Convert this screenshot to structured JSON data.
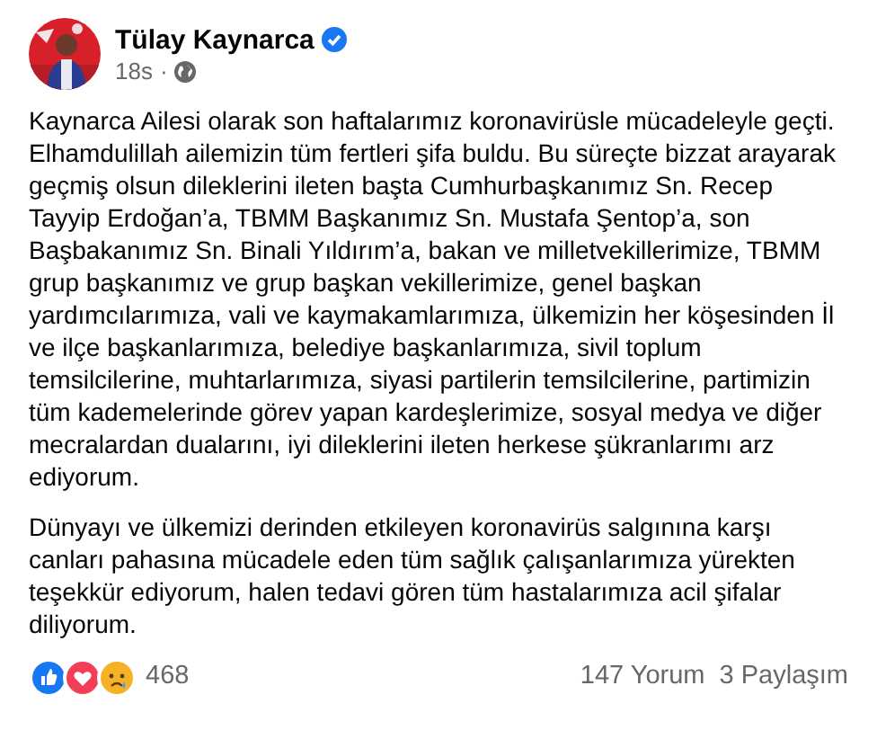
{
  "post": {
    "author": "Tülay Kaynarca",
    "verified": true,
    "time": "18s",
    "separator": "·",
    "avatar": {
      "kind": "picture"
    },
    "paragraphs": [
      "Kaynarca Ailesi olarak son haftalarımız koronavirüsle mücadeleyle geçti. Elhamdulillah ailemizin tüm fertleri şifa buldu. Bu süreçte bizzat arayarak geçmiş olsun dileklerini ileten başta Cumhurbaşkanımız Sn. Recep Tayyip Erdoğan’a, TBMM Başkanımız Sn. Mustafa Şentop’a, son Başbakanımız Sn. Binali Yıldırım’a, bakan ve milletvekillerimize, TBMM grup başkanımız ve grup başkan vekillerimize, genel başkan yardımcılarımıza, vali ve kaymakamlarımıza, ülkemizin her köşesinden İl ve ilçe başkanlarımıza, belediye başkanlarımıza, sivil toplum temsilcilerine, muhtarlarımıza, siyasi partilerin temsilcilerine, partimizin tüm kademelerinde görev yapan kardeşlerimize, sosyal medya ve diğer mecralardan dualarını, iyi dileklerini ileten herkese şükranlarımı arz ediyorum.",
      "Dünyayı ve ülkemizi derinden etkileyen koronavirüs salgınına karşı canları pahasına mücadele eden tüm sağlık çalışanlarımıza yürekten teşekkür ediyorum, halen tedavi gören tüm hastalarımıza acil şifalar diliyorum."
    ],
    "reactions": [
      {
        "kind": "like"
      },
      {
        "kind": "love"
      },
      {
        "kind": "sad"
      }
    ],
    "reaction_count": "468",
    "comments": "147 Yorum",
    "shares": "3 Paylaşım"
  }
}
